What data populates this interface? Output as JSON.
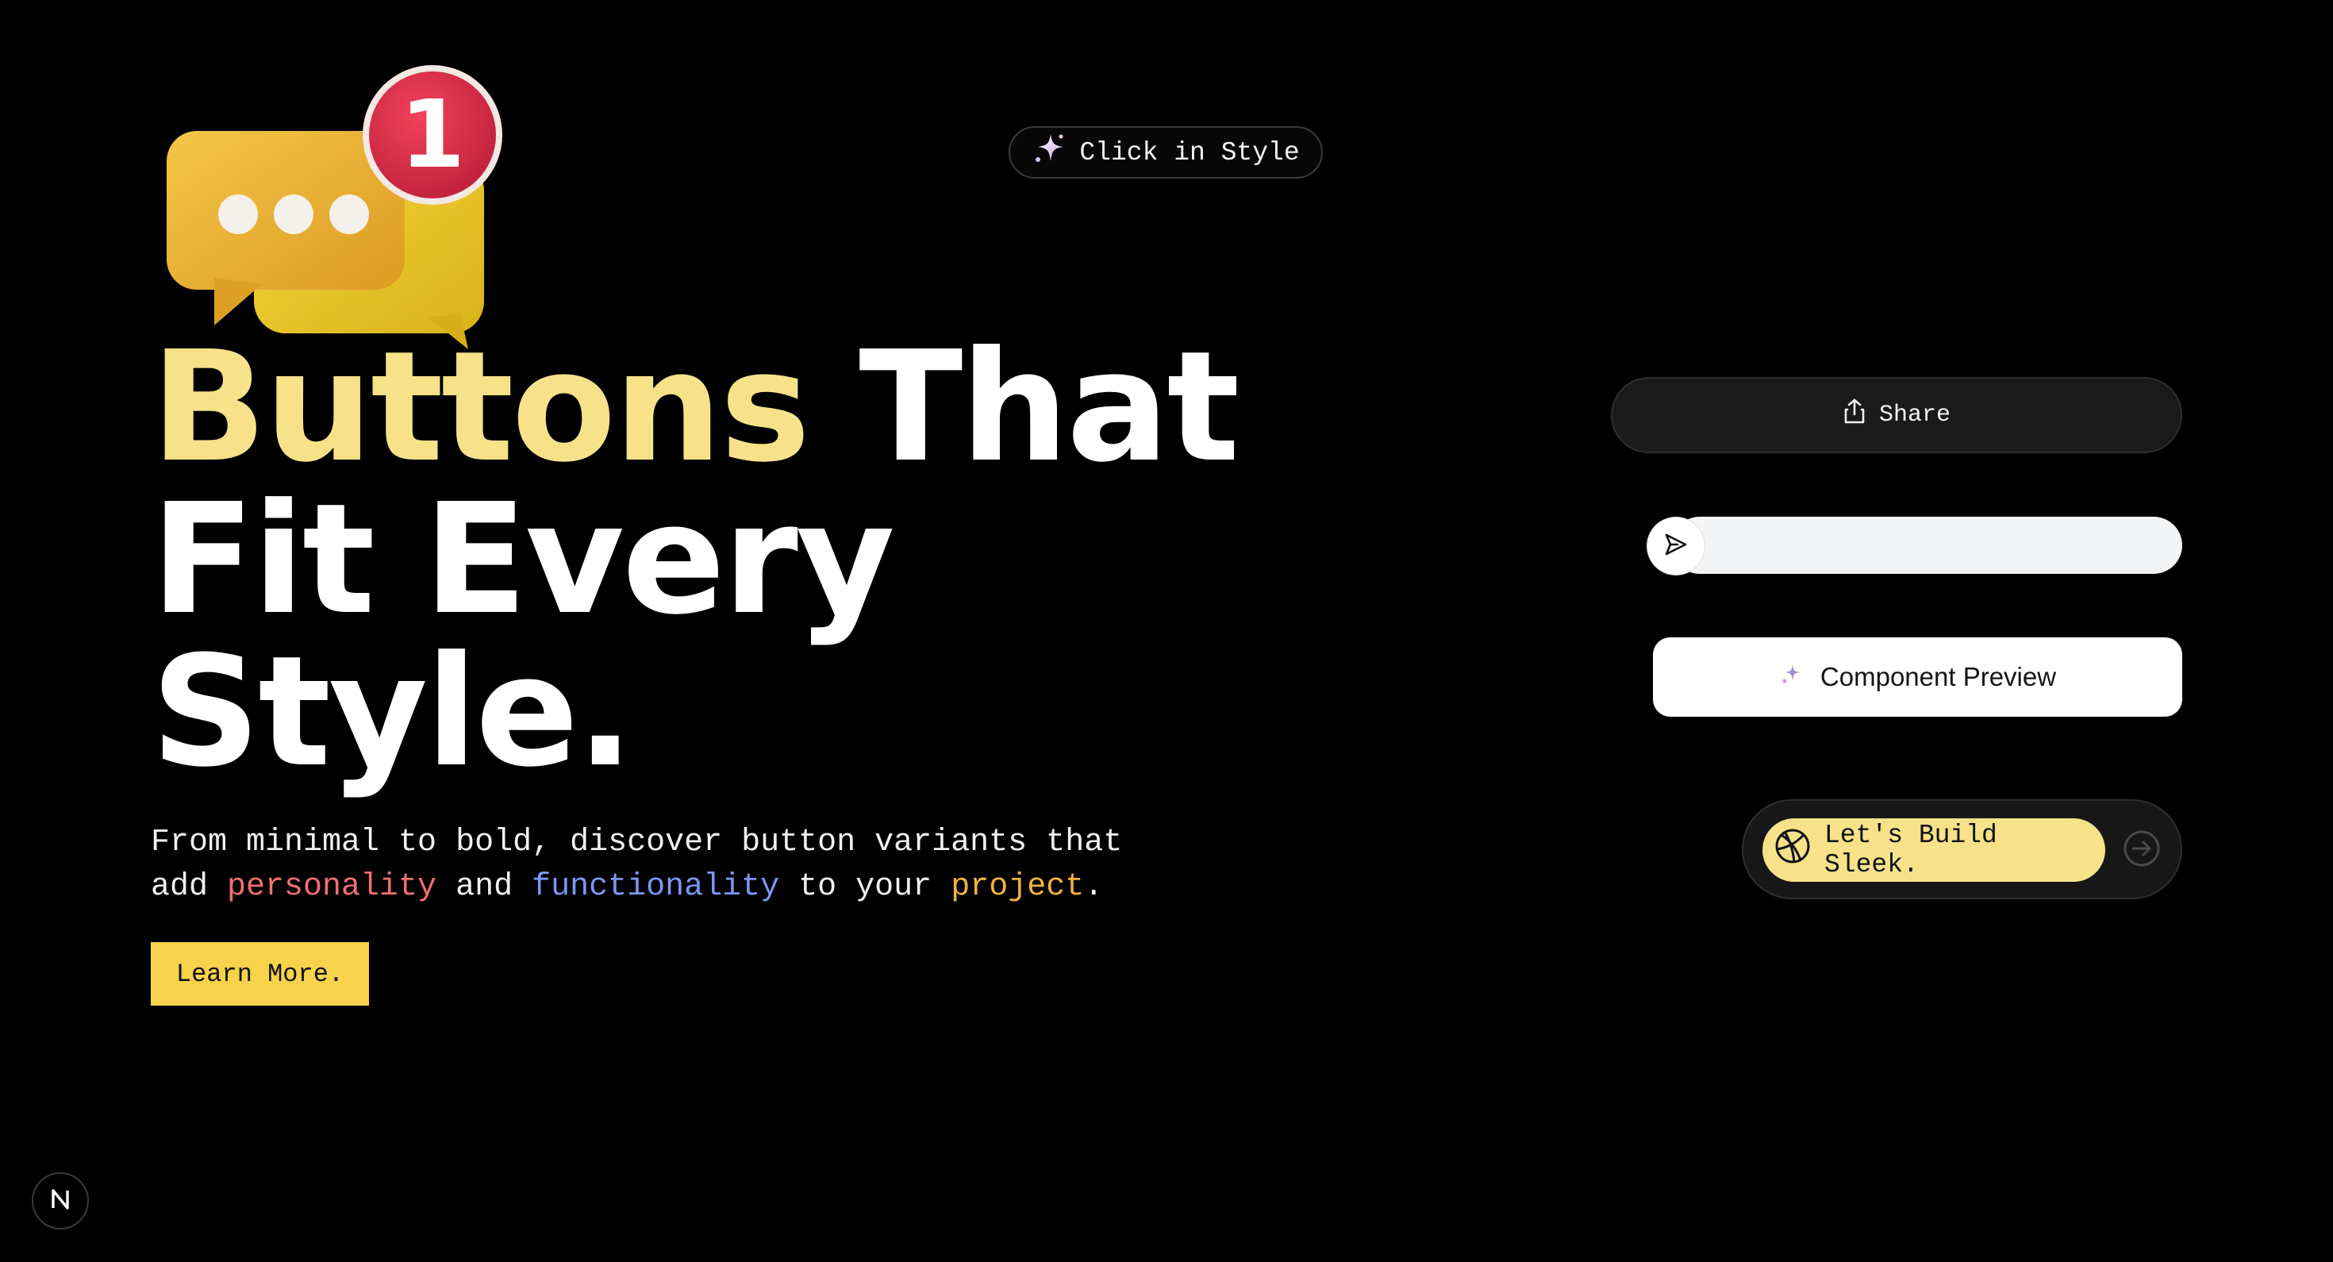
{
  "header": {
    "badge_label": "Click in Style"
  },
  "illustration": {
    "notification_count": "1",
    "icon": "chat-bubble-notification-icon"
  },
  "hero": {
    "headline_accent": "Buttons",
    "headline_line1_rest": " That",
    "headline_line2": "Fit Every",
    "headline_line3": "Style.",
    "subtitle_part1": "From minimal to bold, discover button variants that add ",
    "subtitle_word_personality": "personality",
    "subtitle_part2": " and ",
    "subtitle_word_functionality": "functionality",
    "subtitle_part3": " to your ",
    "subtitle_word_project": "project",
    "subtitle_end": ".",
    "learn_more_label": "Learn More."
  },
  "showcase": {
    "share_label": "Share",
    "send_placeholder": "",
    "component_preview_label": "Component Preview",
    "build_sleek_label": "Let's Build Sleek."
  },
  "colors": {
    "background": "#000000",
    "headline_accent": "#f7e28a",
    "learn_more_bg": "#f6d34a",
    "personality": "#ef6f72",
    "functionality": "#7b97f4",
    "project": "#f3b23d"
  },
  "footer": {
    "badge_letter": "N"
  }
}
